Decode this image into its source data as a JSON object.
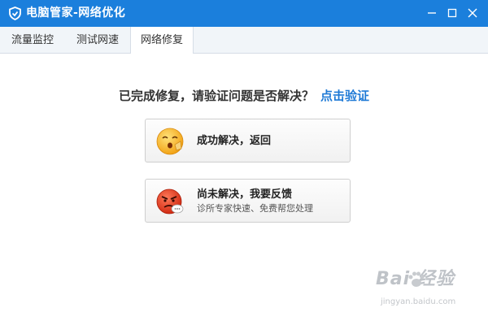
{
  "window": {
    "title": "电脑管家-网络优化",
    "accent_color": "#1b7fdc",
    "icons": [
      "shield-logo-icon",
      "minimize-icon",
      "maximize-icon",
      "close-icon"
    ]
  },
  "tabs": [
    {
      "label": "流量监控",
      "active": false
    },
    {
      "label": "测试网速",
      "active": false
    },
    {
      "label": "网络修复",
      "active": true
    }
  ],
  "main": {
    "prompt": "已完成修复，请验证问题是否解决？",
    "verify_link": "点击验证",
    "link_color": "#1f7ad6",
    "actions": [
      {
        "label": "成功解决，返回",
        "sublabel": "",
        "icon": "happy-face-icon"
      },
      {
        "label": "尚未解决，我要反馈",
        "sublabel": "诊所专家快速、免费帮您处理",
        "icon": "angry-face-icon"
      }
    ]
  },
  "watermark": {
    "logo": "Bai  经验",
    "url": "jingyan.baidu.com"
  }
}
